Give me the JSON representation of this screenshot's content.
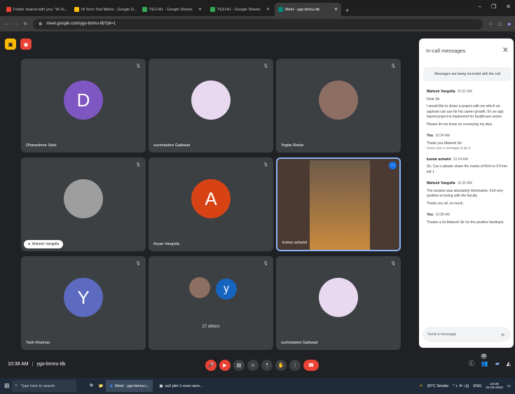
{
  "browser": {
    "tabs": [
      {
        "label": "Folder shared with you: \"IA Te...",
        "color": "#ea4335",
        "active": false
      },
      {
        "label": "IA Term Test Marks - Google D...",
        "color": "#fbbc04",
        "active": false
      },
      {
        "label": "TE2-IA1 - Google Sheets",
        "color": "#34a853",
        "active": false
      },
      {
        "label": "TE3-IA1 - Google Sheets",
        "color": "#34a853",
        "active": false
      },
      {
        "label": "Meet - ygo-bmnu-itb",
        "color": "#00897b",
        "active": true
      }
    ],
    "new_tab": "+",
    "url": "meet.google.com/ygo-bmnu-itb?pli=1"
  },
  "tiles": [
    {
      "name": "Dhanashree Salvi",
      "initial": "D",
      "color": "#7e57c2"
    },
    {
      "name": "suchetadevi Gaikwad",
      "initial": "",
      "color": "#e8d8f0"
    },
    {
      "name": "Yogita Shelar",
      "initial": "",
      "color": "#8d6e63"
    },
    {
      "name": "Mahesh Vangolla",
      "initial": "",
      "color": "#9e9e9e"
    },
    {
      "name": "Aryan Vangolla",
      "initial": "A",
      "color": "#d84315"
    },
    {
      "name": "kumar ashwini",
      "initial": "",
      "color": "#a1887f"
    },
    {
      "name": "Yash Khairnar",
      "initial": "Y",
      "color": "#5c6bc0"
    },
    {
      "name": "27 others",
      "initial": "y",
      "color": "#1565c0"
    },
    {
      "name": "suchetadevi Gaikwad",
      "initial": "",
      "color": "#e8d8f0"
    }
  ],
  "panel": {
    "title": "In-call messages",
    "banner": "Messages are being recorded with the call",
    "messages": [
      {
        "sender": "Mahesh Vangolla",
        "time": "10:32 AM",
        "lines": [
          "Dear Sir",
          "I would like to share a project with me which an aspirant can use for his career growth. It's an app based project to implement for healthcare sector.",
          "Please let me know on conveying my idea"
        ]
      },
      {
        "sender": "You",
        "time": "10:34 AM",
        "lines": [
          "Thank you Mahesh Sir."
        ],
        "hint": "Hover over a message to pin it"
      },
      {
        "sender": "kumar ashwini",
        "time": "10:34 AM",
        "lines": [
          "Sir, Can u please share the marks of Roll no 9 From tcft 1"
        ]
      },
      {
        "sender": "Mahesh Vangolla",
        "time": "10:35 AM",
        "lines": [
          "The session was absolutely informative. Felt very positive on being with the faculty.",
          "Thank you all, so much."
        ]
      },
      {
        "sender": "You",
        "time": "10:38 AM",
        "lines": [
          "Thanks a lot Mahesh Sir for the positive feedback."
        ]
      }
    ],
    "input_placeholder": "Send a message"
  },
  "footer": {
    "time": "10:38 AM",
    "separator": "|",
    "code": "ygo-bmnu-itb",
    "people_count": "30"
  },
  "taskbar": {
    "search": "Type here to search",
    "apps": [
      "Meet - ygo-bmnu-i...",
      "ss2 ptm 1 even sem..."
    ],
    "weather": "30°C Smoke",
    "lang": "ENG",
    "time": "10:38",
    "date": "21-03-2024"
  }
}
